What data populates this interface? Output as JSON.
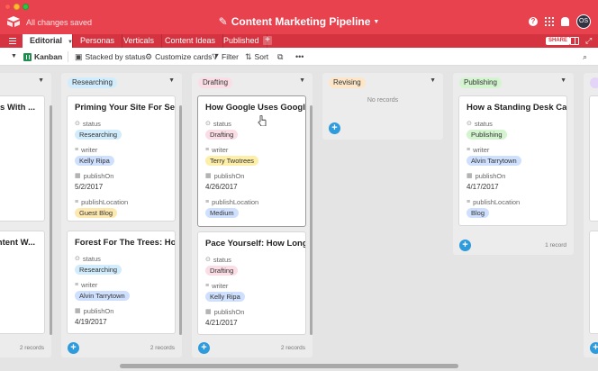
{
  "app": {
    "saved_status": "All changes saved",
    "base_title": "Content Marketing Pipeline",
    "avatar_initials": "OS"
  },
  "tabs": [
    {
      "label": "Editorial",
      "active": true
    },
    {
      "label": "Personas"
    },
    {
      "label": "Verticals"
    },
    {
      "label": "Content Ideas"
    },
    {
      "label": "Published"
    }
  ],
  "header_right": {
    "share_label": "SHARE"
  },
  "toolbar": {
    "view_name": "Kanban",
    "stacked_by": "Stacked by status",
    "customize": "Customize cards",
    "filter": "Filter",
    "sort": "Sort"
  },
  "field_labels": {
    "status": "status",
    "writer": "writer",
    "publishOn": "publishOn",
    "publishLocation": "publishLocation"
  },
  "stacks": [
    {
      "name": "",
      "records_label": "2 records",
      "cards": [
        {
          "title": "ss With ..."
        },
        {
          "title": "ontent W..."
        }
      ]
    },
    {
      "name": "Researching",
      "records_label": "2 records",
      "cards": [
        {
          "title": "Priming Your Site For Se...",
          "status": "Researching",
          "writer": "Kelly Ripa",
          "publishOn": "5/2/2017",
          "publishLocation": "Guest Blog"
        },
        {
          "title": "Forest For The Trees: How...",
          "status": "Researching",
          "writer": "Alvin Tarrytown",
          "publishOn": "4/19/2017"
        }
      ]
    },
    {
      "name": "Drafting",
      "records_label": "2 records",
      "cards": [
        {
          "title": "How Google Uses Google",
          "status": "Drafting",
          "writer": "Terry Twotrees",
          "publishOn": "4/26/2017",
          "publishLocation": "Medium"
        },
        {
          "title": "Pace Yourself: How Long...",
          "status": "Drafting",
          "writer": "Kelly Ripa",
          "publishOn": "4/21/2017"
        }
      ]
    },
    {
      "name": "Revising",
      "no_records": "No records",
      "cards": []
    },
    {
      "name": "Publishing",
      "records_label": "1 record",
      "cards": [
        {
          "title": "How a Standing Desk Ca...",
          "status": "Publishing",
          "writer": "Alvin Tarrytown",
          "publishOn": "4/17/2017",
          "publishLocation": "Blog"
        }
      ]
    }
  ]
}
